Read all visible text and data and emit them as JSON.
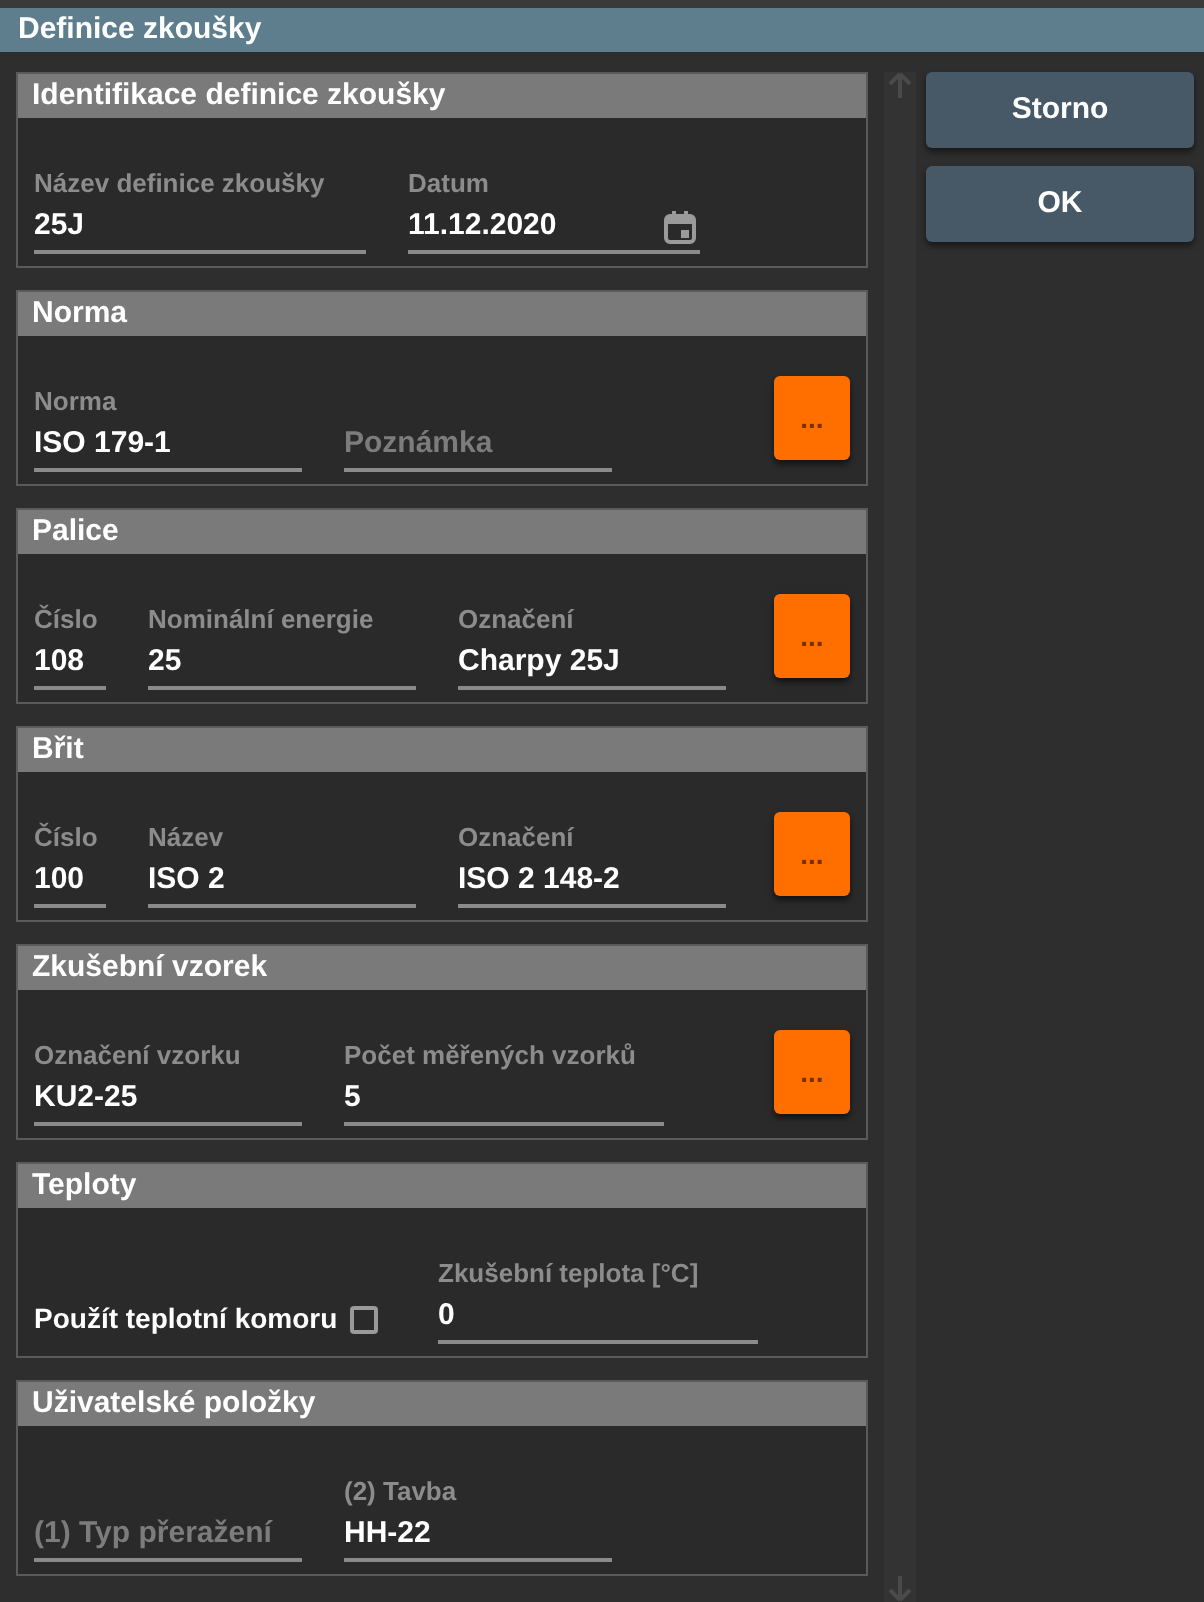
{
  "window": {
    "title": "Definice zkoušky"
  },
  "sections": [
    {
      "title": "Identifikace definice zkoušky",
      "fields": [
        {
          "kind": "wide",
          "label": "Název definice zkoušky",
          "value": "25J"
        },
        {
          "kind": "date",
          "label": "Datum",
          "value": "11.12.2020"
        }
      ]
    },
    {
      "title": "Norma",
      "fields": [
        {
          "kind": "normal",
          "label": "Norma",
          "value": "ISO 179-1"
        },
        {
          "kind": "normal",
          "placeholder": "Poznámka"
        }
      ],
      "browse_button": "..."
    },
    {
      "title": "Palice",
      "fields": [
        {
          "kind": "short",
          "label": "Číslo",
          "value": "108"
        },
        {
          "kind": "normal",
          "label": "Nominální energie",
          "value": "25"
        },
        {
          "kind": "normal",
          "label": "Označení",
          "value": "Charpy 25J"
        }
      ],
      "browse_button": "..."
    },
    {
      "title": "Břit",
      "fields": [
        {
          "kind": "short",
          "label": "Číslo",
          "value": "100"
        },
        {
          "kind": "normal",
          "label": "Název",
          "value": "ISO 2"
        },
        {
          "kind": "normal",
          "label": "Označení",
          "value": "ISO 2 148-2"
        }
      ],
      "browse_button": "..."
    },
    {
      "title": "Zkušební vzorek",
      "fields": [
        {
          "kind": "normal",
          "label": "Označení vzorku",
          "value": "KU2-25"
        },
        {
          "kind": "long",
          "label": "Počet měřených vzorků",
          "value": "5"
        }
      ],
      "browse_button": "..."
    },
    {
      "title": "Teploty",
      "checkbox": {
        "label": "Použít teplotní komoru",
        "checked": false
      },
      "fields": [
        {
          "kind": "long",
          "label": "Zkušební teplota [°C]",
          "value": "0"
        }
      ]
    },
    {
      "title": "Uživatelské položky",
      "fields": [
        {
          "kind": "normal",
          "placeholder": "(1) Typ přeražení"
        },
        {
          "kind": "normal",
          "label": "(2) Tavba",
          "value": "HH-22"
        }
      ]
    }
  ],
  "buttons": [
    {
      "label": "Storno"
    },
    {
      "label": "OK"
    }
  ]
}
